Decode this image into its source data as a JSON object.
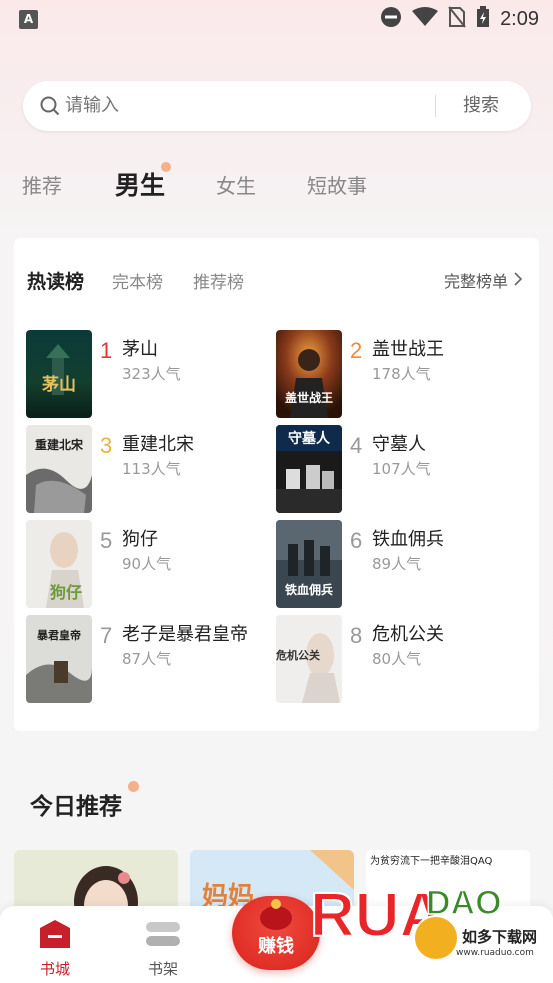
{
  "status": {
    "app_badge": "A",
    "time": "2:09"
  },
  "search": {
    "placeholder": "请输入",
    "button": "搜索"
  },
  "tabs": [
    {
      "label": "推荐",
      "active": false
    },
    {
      "label": "男生",
      "active": true
    },
    {
      "label": "女生",
      "active": false
    },
    {
      "label": "短故事",
      "active": false
    }
  ],
  "ranking": {
    "tabs": [
      {
        "label": "热读榜",
        "active": true
      },
      {
        "label": "完本榜",
        "active": false
      },
      {
        "label": "推荐榜",
        "active": false
      }
    ],
    "full_list": "完整榜单",
    "books": [
      {
        "rank": "1",
        "title": "茅山",
        "popularity": "323人气",
        "rank_color": "#e0353c"
      },
      {
        "rank": "2",
        "title": "盖世战王",
        "popularity": "178人气",
        "rank_color": "#f08a3a"
      },
      {
        "rank": "3",
        "title": "重建北宋",
        "popularity": "113人气",
        "rank_color": "#e9b43a"
      },
      {
        "rank": "4",
        "title": "守墓人",
        "popularity": "107人气",
        "rank_color": "#999999"
      },
      {
        "rank": "5",
        "title": "狗仔",
        "popularity": "90人气",
        "rank_color": "#999999"
      },
      {
        "rank": "6",
        "title": "铁血佣兵",
        "popularity": "89人气",
        "rank_color": "#999999"
      },
      {
        "rank": "7",
        "title": "老子是暴君皇帝",
        "popularity": "87人气",
        "rank_color": "#999999"
      },
      {
        "rank": "8",
        "title": "危机公关",
        "popularity": "80人气",
        "rank_color": "#999999"
      }
    ],
    "cover_texts": [
      "茅山",
      "盖世战王",
      "重建北宋",
      "守墓人",
      "狗仔",
      "铁血佣兵",
      "暴君皇帝",
      "危机公关"
    ]
  },
  "today": {
    "title": "今日推荐",
    "card2_text": "妈妈",
    "card3_text": "为贫穷流下一把辛酸泪QAQ"
  },
  "bottom_nav": {
    "items": [
      {
        "label": "书城",
        "active": true
      },
      {
        "label": "书架",
        "active": false
      }
    ],
    "earn": "赚钱"
  },
  "watermark": {
    "brand": "RUANDAO",
    "name": "如多下载网",
    "url": "www.ruaduo.com"
  },
  "colors": {
    "accent": "#d42b2b",
    "rank_1": "#e0353c",
    "rank_2": "#f08a3a",
    "rank_3": "#e9b43a"
  }
}
